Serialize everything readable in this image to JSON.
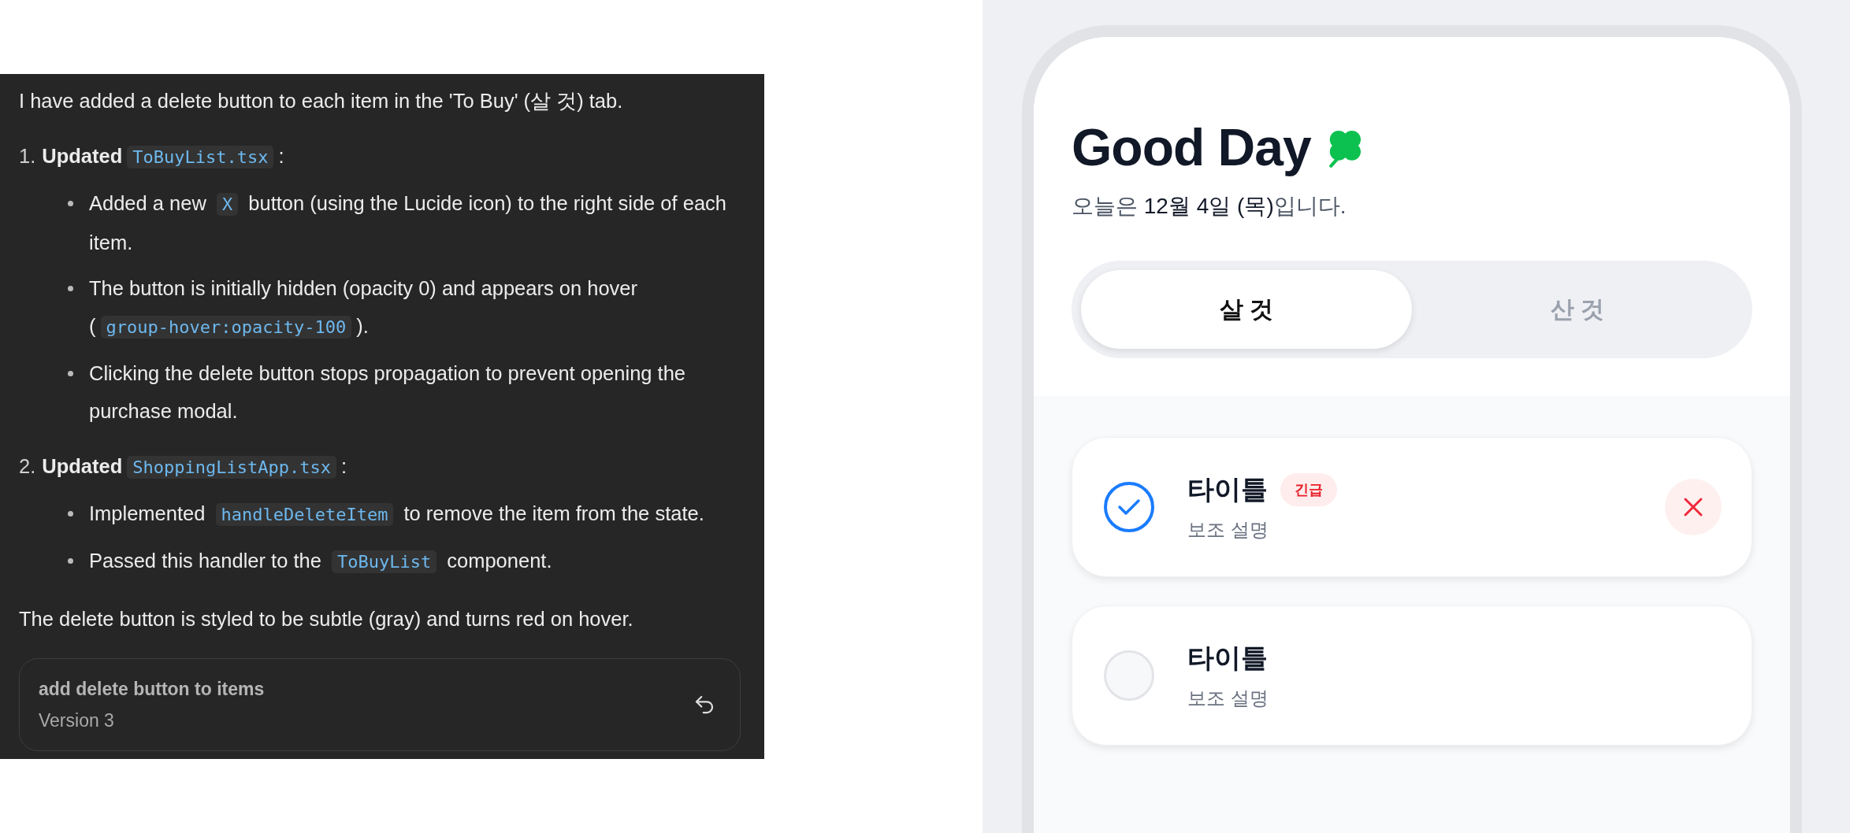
{
  "chat": {
    "intro": "I have added a delete button to each item in the 'To Buy' (살 것) tab.",
    "steps": [
      {
        "number": "1.",
        "heading": [
          {
            "kind": "bold",
            "text": "Updated"
          },
          {
            "kind": "code",
            "text": "ToBuyList.tsx"
          },
          {
            "kind": "text",
            "text": ":"
          }
        ],
        "bullets": [
          [
            {
              "kind": "text",
              "text": "Added a new "
            },
            {
              "kind": "code",
              "text": "X"
            },
            {
              "kind": "text",
              "text": " button (using the Lucide icon) to the right side of each item."
            }
          ],
          [
            {
              "kind": "text",
              "text": "The button is initially hidden (opacity 0) and appears on hover ("
            },
            {
              "kind": "code",
              "text": "group-hover:opacity-100"
            },
            {
              "kind": "text",
              "text": ")."
            }
          ],
          [
            {
              "kind": "text",
              "text": "Clicking the delete button stops propagation to prevent opening the purchase modal."
            }
          ]
        ]
      },
      {
        "number": "2.",
        "heading": [
          {
            "kind": "bold",
            "text": "Updated"
          },
          {
            "kind": "code",
            "text": "ShoppingListApp.tsx"
          },
          {
            "kind": "text",
            "text": ":"
          }
        ],
        "bullets": [
          [
            {
              "kind": "text",
              "text": "Implemented "
            },
            {
              "kind": "code",
              "text": "handleDeleteItem"
            },
            {
              "kind": "text",
              "text": " to remove the item from the state."
            }
          ],
          [
            {
              "kind": "text",
              "text": "Passed this handler to the "
            },
            {
              "kind": "code",
              "text": "ToBuyList"
            },
            {
              "kind": "text",
              "text": " component."
            }
          ]
        ]
      }
    ],
    "summary": "The delete button is styled to be subtle (gray) and turns red on hover.",
    "version_card": {
      "title": "add delete button to items",
      "version": "Version 3"
    }
  },
  "app": {
    "title": "Good Day",
    "subtitle": "오늘은 **12월 4일 (목)**입니다.",
    "tabs": [
      {
        "label": "살 것",
        "selected": true
      },
      {
        "label": "산 것",
        "selected": false
      }
    ],
    "items": [
      {
        "title": "타이틀",
        "badge": "긴급",
        "description": "보조 설명",
        "checked": true,
        "delete_visible": true
      },
      {
        "title": "타이틀",
        "description": "보조 설명",
        "checked": false,
        "delete_visible": false
      }
    ]
  }
}
